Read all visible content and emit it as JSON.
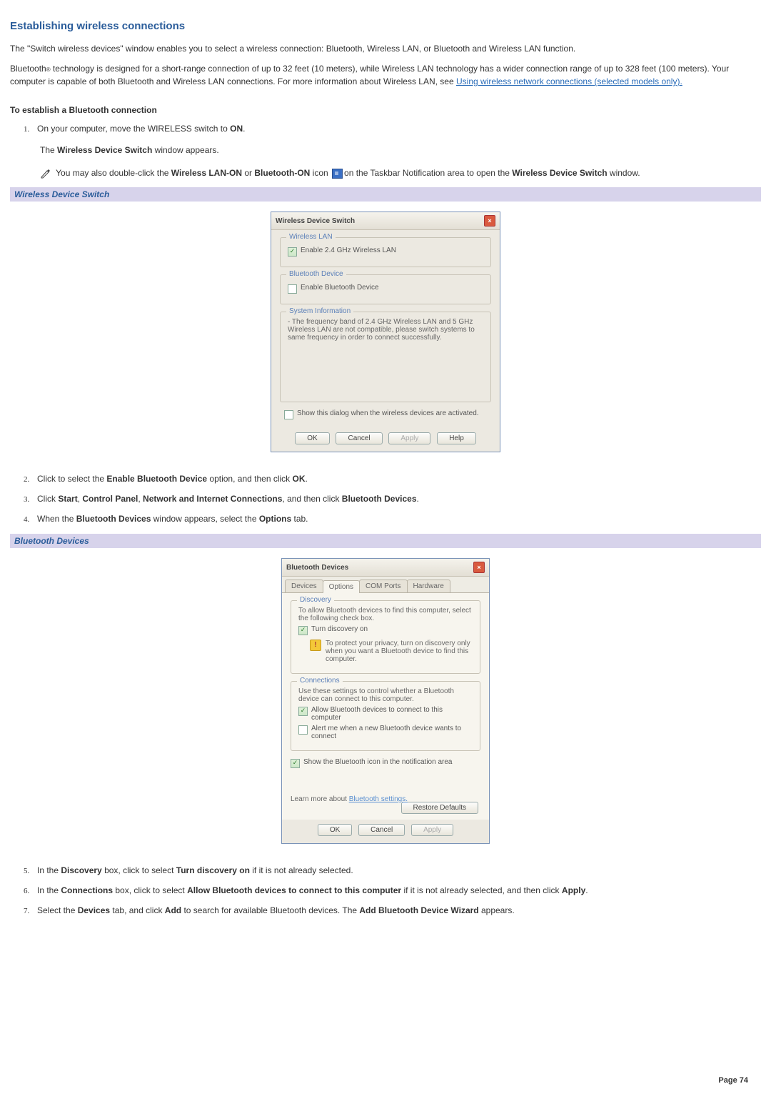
{
  "title": "Establishing wireless connections",
  "para1": "The \"Switch wireless devices\" window enables you to select a wireless connection: Bluetooth, Wireless LAN, or Bluetooth and Wireless LAN function.",
  "para2_pre": "Bluetooth",
  "para2_sub": "®",
  "para2_post": " technology is designed for a short-range connection of up to 32 feet (10 meters), while Wireless LAN technology has a wider connection range of up to 328 feet (100 meters). Your computer is capable of both Bluetooth and Wireless LAN connections. For more information about Wireless LAN, see ",
  "link1": "Using wireless network connections (selected models only).",
  "h_bt": "To establish a Bluetooth connection",
  "s1a": "On your computer, move the WIRELESS switch to ",
  "s1b": "ON",
  "s1c": ".",
  "s1_sub_a": "The ",
  "s1_sub_b": "Wireless Device Switch",
  "s1_sub_c": " window appears.",
  "note_a": " You may also double-click the ",
  "note_b": "Wireless LAN-ON",
  "note_c": " or ",
  "note_d": "Bluetooth-ON",
  "note_e": " icon ",
  "note_f": "on the Taskbar Notification area to open the ",
  "note_g": "Wireless Device Switch",
  "note_h": " window.",
  "cap1": "Wireless Device Switch",
  "dlg1": {
    "title": "Wireless Device Switch",
    "g1": "Wireless LAN",
    "c1": "Enable 2.4 GHz Wireless LAN",
    "g2": "Bluetooth Device",
    "c2": "Enable Bluetooth Device",
    "g3": "System Information",
    "info": "- The frequency band of 2.4 GHz Wireless LAN and 5 GHz Wireless LAN are not compatible, please switch systems to same frequency in order to connect successfully.",
    "show": "Show this dialog when the wireless devices are activated.",
    "ok": "OK",
    "cancel": "Cancel",
    "apply": "Apply",
    "help": "Help"
  },
  "s2a": "Click to select the ",
  "s2b": "Enable Bluetooth Device",
  "s2c": " option, and then click ",
  "s2d": "OK",
  "s2e": ".",
  "s3a": "Click ",
  "s3b": "Start",
  "s3c": ", ",
  "s3d": "Control Panel",
  "s3e": ", ",
  "s3f": "Network and Internet Connections",
  "s3g": ", and then click ",
  "s3h": "Bluetooth Devices",
  "s3i": ".",
  "s4a": "When the ",
  "s4b": "Bluetooth Devices",
  "s4c": " window appears, select the ",
  "s4d": "Options",
  "s4e": " tab.",
  "cap2": "Bluetooth Devices",
  "dlg2": {
    "title": "Bluetooth Devices",
    "tabs": [
      "Devices",
      "Options",
      "COM Ports",
      "Hardware"
    ],
    "g1": "Discovery",
    "d1": "To allow Bluetooth devices to find this computer, select the following check box.",
    "d2": "Turn discovery on",
    "d3": "To protect your privacy, turn on discovery only when you want a Bluetooth device to find this computer.",
    "g2": "Connections",
    "c1": "Use these settings to control whether a Bluetooth device can connect to this computer.",
    "c2": "Allow Bluetooth devices to connect to this computer",
    "c3": "Alert me when a new Bluetooth device wants to connect",
    "show": "Show the Bluetooth icon in the notification area",
    "learn": "Learn more about ",
    "learnlink": "Bluetooth settings.",
    "restore": "Restore Defaults",
    "ok": "OK",
    "cancel": "Cancel",
    "apply": "Apply"
  },
  "s5a": "In the ",
  "s5b": "Discovery",
  "s5c": " box, click to select ",
  "s5d": "Turn discovery on",
  "s5e": " if it is not already selected.",
  "s6a": "In the ",
  "s6b": "Connections",
  "s6c": " box, click to select ",
  "s6d": "Allow Bluetooth devices to connect to this computer",
  "s6e": " if it is not already selected, and then click ",
  "s6f": "Apply",
  "s6g": ".",
  "s7a": "Select the ",
  "s7b": "Devices",
  "s7c": " tab, and click ",
  "s7d": "Add",
  "s7e": " to search for available Bluetooth devices. The ",
  "s7f": "Add Bluetooth Device Wizard",
  "s7g": " appears.",
  "page": "Page 74"
}
